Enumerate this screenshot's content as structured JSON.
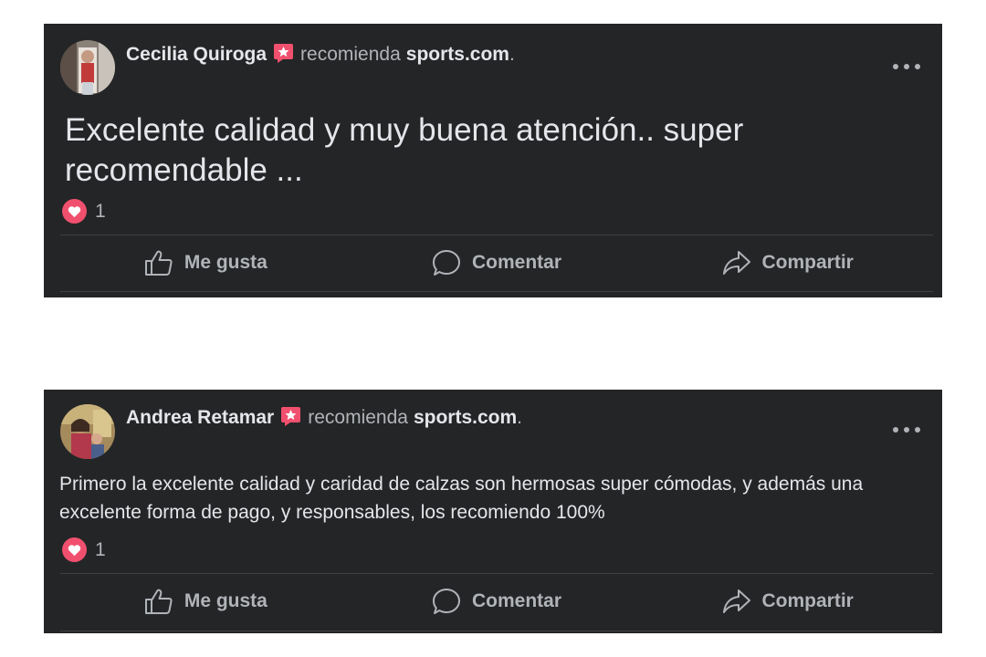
{
  "posts": [
    {
      "author": "Cecilia Quiroga",
      "verb": "recomienda",
      "page": "sports.com",
      "punct": ".",
      "text": "Excelente calidad y muy buena atención.. super recomendable ...",
      "reaction_count": "1",
      "actions": {
        "like": "Me gusta",
        "comment": "Comentar",
        "share": "Compartir"
      }
    },
    {
      "author": "Andrea Retamar",
      "verb": "recomienda",
      "page": "sports.com",
      "punct": ".",
      "text": "Primero la excelente calidad y caridad de calzas son hermosas super cómodas, y además una excelente forma de pago, y responsables, los recomiendo 100%",
      "reaction_count": "1",
      "actions": {
        "like": "Me gusta",
        "comment": "Comentar",
        "share": "Compartir"
      }
    }
  ],
  "icons": {
    "recommend": "recommend-star-icon",
    "more": "more-options-icon",
    "reaction": "heart-reaction-icon",
    "like": "thumbs-up-icon",
    "comment": "comment-bubble-icon",
    "share": "share-arrow-icon"
  },
  "colors": {
    "card_bg": "#242526",
    "primary_text": "#e4e6eb",
    "secondary_text": "#b0b3b8",
    "recommend_badge": "#f0506e",
    "heart_badge": "#f0506e"
  }
}
